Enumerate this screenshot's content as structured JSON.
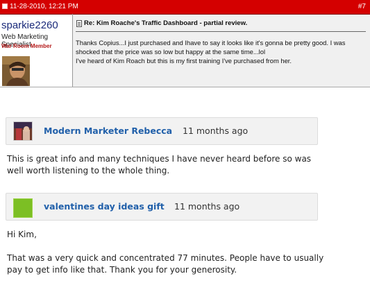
{
  "forum_post": {
    "date": "11-28-2010, 12:21 PM",
    "post_number": "#7",
    "username": "sparkie2260",
    "user_title": "Web Marketing Specialist",
    "user_rank": "War Room Member",
    "title": "Re: Kim Roache's Traffic Dashboard - partial review.",
    "body_line1": "Thanks Copius...I just purchased and Ihave to say it looks like it's gonna be pretty good. I was shocked that the price was so low but happy at the same time...lol",
    "body_line2": "I've heard of Kim Roach but this is my first training I've purchased from her."
  },
  "comments": [
    {
      "author": "Modern Marketer Rebecca",
      "time": "11 months ago",
      "text": "This is great info and many techniques I have never heard before so was well worth listening to the whole thing.",
      "avatar": "photo-avatar"
    },
    {
      "author": "valentines day ideas gift",
      "time": "11 months ago",
      "greeting": "Hi Kim,",
      "text": "That was a very quick and concentrated 77 minutes. People have to usually pay to get info like that. Thank you for your generosity.",
      "avatar": "green-square-avatar",
      "avatar_color": "#7cbf24"
    }
  ],
  "colors": {
    "forum_bar": "#d40000",
    "link_blue": "#2160aa",
    "username_blue": "#1a2a7a",
    "rank_red": "#b41818"
  }
}
